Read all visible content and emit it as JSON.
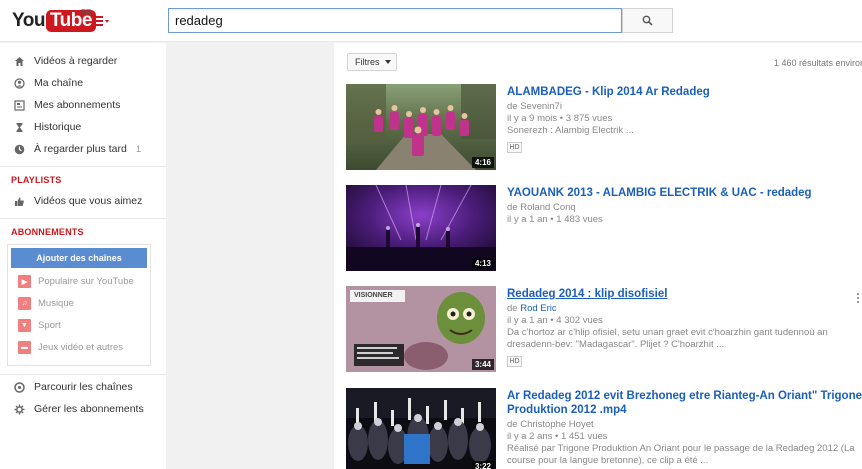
{
  "header": {
    "logo_you": "You",
    "logo_tube": "Tube",
    "logo_region": "FR",
    "search_value": "redadeg"
  },
  "sidebar": {
    "nav": [
      {
        "label": "Vidéos à regarder",
        "icon": "home-icon"
      },
      {
        "label": "Ma chaîne",
        "icon": "user-icon"
      },
      {
        "label": "Mes abonnements",
        "icon": "subscriptions-icon"
      },
      {
        "label": "Historique",
        "icon": "hourglass-icon"
      },
      {
        "label": "À regarder plus tard",
        "icon": "clock-icon",
        "count": "1"
      }
    ],
    "playlists_title": "PLAYLISTS",
    "liked_videos": "Vidéos que vous aimez",
    "subscriptions_title": "ABONNEMENTS",
    "add_channels": "Ajouter des chaînes",
    "channels": [
      {
        "label": "Populaire sur YouTube",
        "icon": "popular-icon"
      },
      {
        "label": "Musique",
        "icon": "music-icon"
      },
      {
        "label": "Sport",
        "icon": "sport-icon"
      },
      {
        "label": "Jeux vidéo et autres",
        "icon": "gaming-icon"
      }
    ],
    "browse_channels": "Parcourir les chaînes",
    "manage_subscriptions": "Gérer les abonnements"
  },
  "main": {
    "filter_label": "Filtres",
    "results_count": "1 460 résultats environ",
    "results": [
      {
        "title": "ALAMBADEG - Klip 2014 Ar Redadeg",
        "by": "de",
        "author": "Sevenin7i",
        "age": "il y a 9 mois",
        "views": "3 875 vues",
        "description": "Sonerezh : Alambig Electrik ...",
        "badge": "HD",
        "duration": "4:16"
      },
      {
        "title": "YAOUANK 2013 - ALAMBIG ELECTRIK & UAC - redadeg",
        "by": "de",
        "author": "Roland Conq",
        "age": "il y a 1 an",
        "views": "1 483 vues",
        "duration": "4:13"
      },
      {
        "title": "Redadeg 2014 : klip disofisiel",
        "by": "de",
        "author": "Rod Eric",
        "age": "il y a 1 an",
        "views": "4 302 vues",
        "description_line1": "Da c'hortoz ar c'hlip ofisiel, setu unan graet evit c'hoarzhin gant tudennoù an",
        "description_line2": "dresadenn-bev: \"Madagascar\". Plijet ? C'hoarzhit ...",
        "badge": "HD",
        "duration": "3:44",
        "thumb_label": "VISIONNER"
      },
      {
        "title_line1": "Ar Redadeg 2012 evit Brezhoneg etre Rianteg-An Oriant\" Trigone",
        "title_line2": "Produktion 2012 .mp4",
        "by": "de",
        "author": "Christophe Hoyet",
        "age": "il y a 2 ans",
        "views": "1 451 vues",
        "description_line1": "Réalisé par Trigone Produktion An Oriant pour le passage de la Redadeg 2012 (La",
        "description_line2": "course pour la langue bretonne), ce clip a été ...",
        "duration": "3:22"
      }
    ]
  },
  "colors": {
    "brand_red": "#cc181e",
    "link_blue": "#1b5fbc",
    "add_channels_blue": "#5a8cd1"
  }
}
